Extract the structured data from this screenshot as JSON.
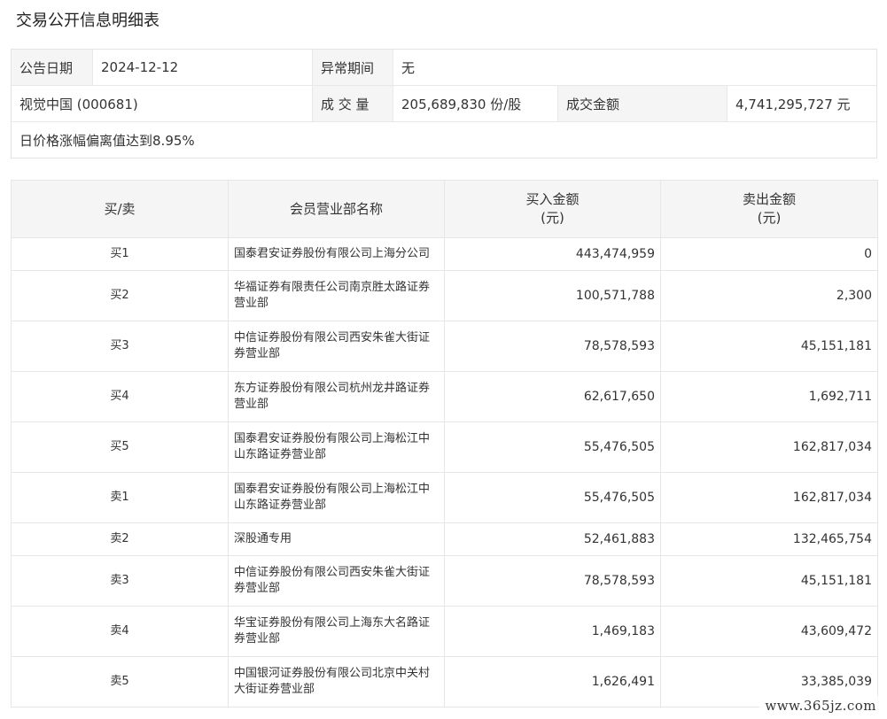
{
  "title": "交易公开信息明细表",
  "info": {
    "announce_date_label": "公告日期",
    "announce_date": "2024-12-12",
    "abnormal_period_label": "异常期间",
    "abnormal_period": "无",
    "stock": "视觉中国 (000681)",
    "volume_label": "成 交 量",
    "volume": "205,689,830 份/股",
    "amount_label": "成交金额",
    "amount": "4,741,295,727 元",
    "reason": "日价格涨幅偏离值达到8.95%"
  },
  "table": {
    "headers": {
      "side": "买/卖",
      "branch": "会员营业部名称",
      "buy_line1": "买入金额",
      "buy_line2": "(元)",
      "sell_line1": "卖出金额",
      "sell_line2": "(元)"
    },
    "rows": [
      {
        "side": "买1",
        "branch": "国泰君安证券股份有限公司上海分公司",
        "buy": "443,474,959",
        "sell": "0"
      },
      {
        "side": "买2",
        "branch": "华福证券有限责任公司南京胜太路证券营业部",
        "buy": "100,571,788",
        "sell": "2,300"
      },
      {
        "side": "买3",
        "branch": "中信证券股份有限公司西安朱雀大街证券营业部",
        "buy": "78,578,593",
        "sell": "45,151,181"
      },
      {
        "side": "买4",
        "branch": "东方证券股份有限公司杭州龙井路证券营业部",
        "buy": "62,617,650",
        "sell": "1,692,711"
      },
      {
        "side": "买5",
        "branch": "国泰君安证券股份有限公司上海松江中山东路证券营业部",
        "buy": "55,476,505",
        "sell": "162,817,034"
      },
      {
        "side": "卖1",
        "branch": "国泰君安证券股份有限公司上海松江中山东路证券营业部",
        "buy": "55,476,505",
        "sell": "162,817,034"
      },
      {
        "side": "卖2",
        "branch": "深股通专用",
        "buy": "52,461,883",
        "sell": "132,465,754"
      },
      {
        "side": "卖3",
        "branch": "中信证券股份有限公司西安朱雀大街证券营业部",
        "buy": "78,578,593",
        "sell": "45,151,181"
      },
      {
        "side": "卖4",
        "branch": "华宝证券股份有限公司上海东大名路证券营业部",
        "buy": "1,469,183",
        "sell": "43,609,472"
      },
      {
        "side": "卖5",
        "branch": "中国银河证券股份有限公司北京中关村大街证券营业部",
        "buy": "1,626,491",
        "sell": "33,385,039"
      }
    ]
  },
  "watermark": "www.365jz.com"
}
